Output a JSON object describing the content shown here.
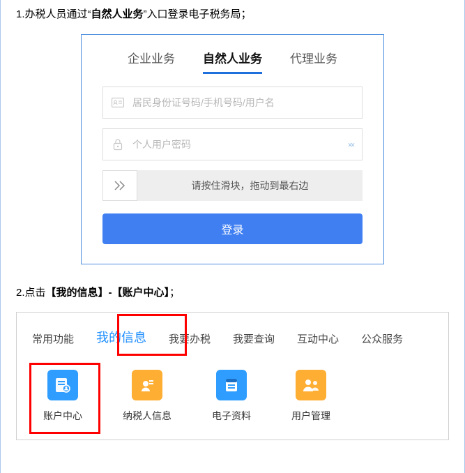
{
  "step1": {
    "prefix": "1.办税人员通过",
    "quote_open": "“",
    "bold": "自然人业务",
    "quote_close": "”",
    "suffix": "入口登录电子税务局；"
  },
  "login": {
    "tabs": [
      {
        "label": "企业业务"
      },
      {
        "label": "自然人业务"
      },
      {
        "label": "代理业务"
      }
    ],
    "id_placeholder": "居民身份证号码/手机号码/用户名",
    "pwd_placeholder": "个人用户密码",
    "slider_text": "请按住滑块，拖动到最右边",
    "login_btn": "登录"
  },
  "step2": {
    "prefix": "2.点击",
    "bold": "【我的信息】-【账户中心】",
    "suffix": "；"
  },
  "nav": {
    "tabs": [
      "常用功能",
      "我的信息",
      "我要办税",
      "我要查询",
      "互动中心",
      "公众服务"
    ],
    "tiles": [
      "账户中心",
      "纳税人信息",
      "电子资料",
      "用户管理"
    ]
  }
}
